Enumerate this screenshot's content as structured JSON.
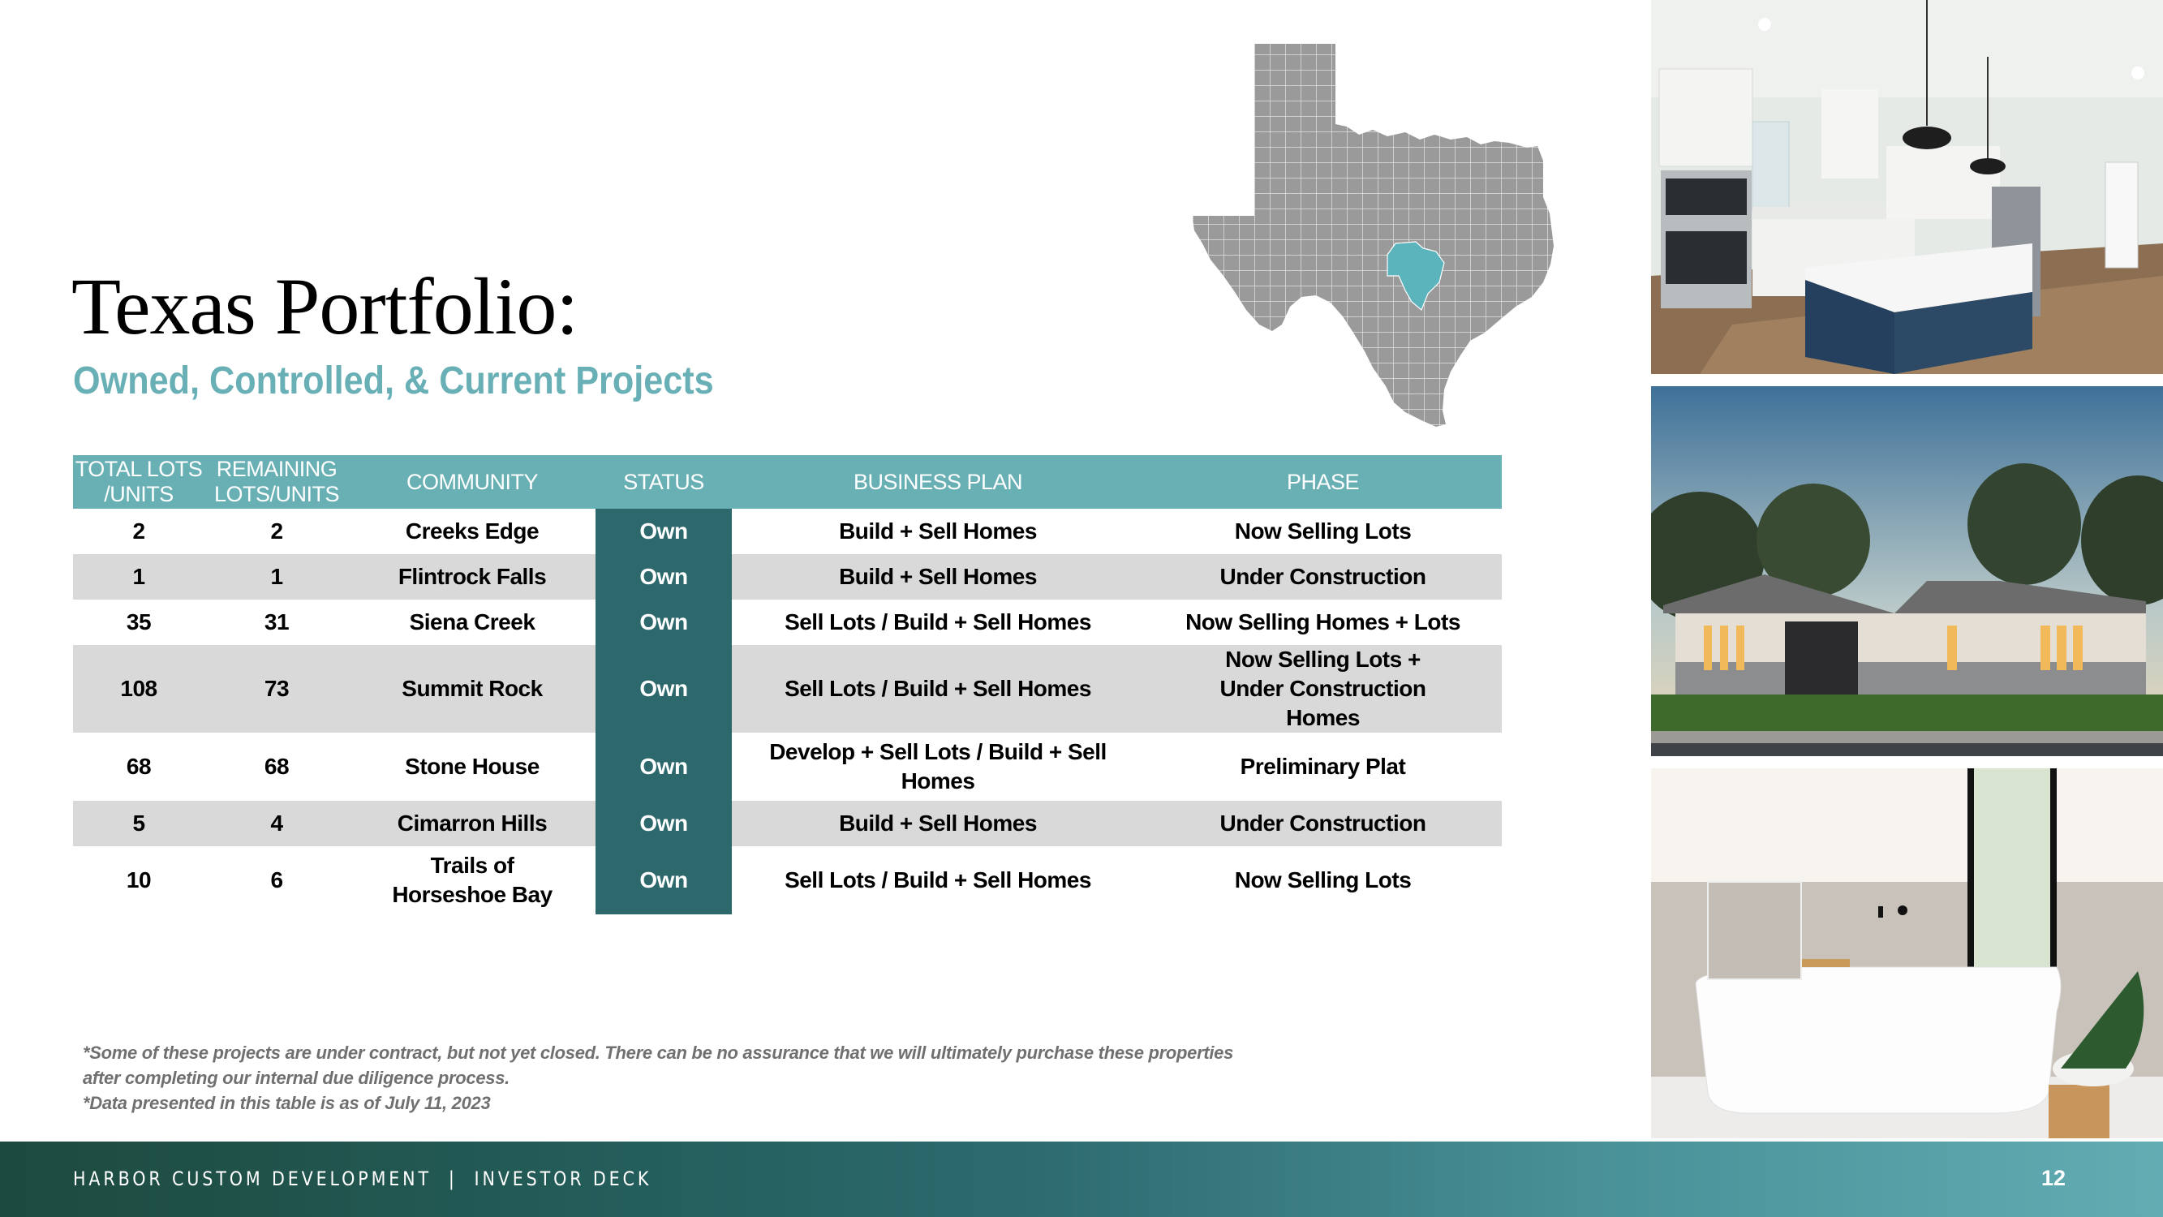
{
  "slide": {
    "title": "Texas Portfolio:",
    "subtitle": "Owned, Controlled,  & Current Projects"
  },
  "map": {
    "label": "Texas county map",
    "base_color": "#9A9A9A",
    "highlight_color": "#5BB3BC"
  },
  "table": {
    "headers": {
      "total": "TOTAL LOTS /UNITS",
      "remaining": "REMAINING LOTS/UNITS",
      "community": "COMMUNITY",
      "status": "STATUS",
      "business_plan": "BUSINESS PLAN",
      "phase": "PHASE"
    },
    "rows": [
      {
        "total": "2",
        "remaining": "2",
        "community": "Creeks Edge",
        "status": "Own",
        "business_plan": "Build + Sell Homes",
        "phase": "Now Selling Lots"
      },
      {
        "total": "1",
        "remaining": "1",
        "community": "Flintrock Falls",
        "status": "Own",
        "business_plan": "Build + Sell Homes",
        "phase": "Under Construction"
      },
      {
        "total": "35",
        "remaining": "31",
        "community": "Siena Creek",
        "status": "Own",
        "business_plan": "Sell Lots / Build + Sell Homes",
        "phase": "Now Selling Homes + Lots"
      },
      {
        "total": "108",
        "remaining": "73",
        "community": "Summit Rock",
        "status": "Own",
        "business_plan": "Sell Lots / Build + Sell Homes",
        "phase": "Now Selling Lots + Under Construction Homes"
      },
      {
        "total": "68",
        "remaining": "68",
        "community": "Stone House",
        "status": "Own",
        "business_plan": "Develop + Sell Lots / Build + Sell Homes",
        "phase": "Preliminary Plat"
      },
      {
        "total": "5",
        "remaining": "4",
        "community": "Cimarron Hills",
        "status": "Own",
        "business_plan": "Build + Sell Homes",
        "phase": "Under Construction"
      },
      {
        "total": "10",
        "remaining": "6",
        "community": "Trails of Horseshoe Bay",
        "status": "Own",
        "business_plan": "Sell Lots / Build + Sell Homes",
        "phase": "Now Selling Lots"
      }
    ]
  },
  "footnotes": [
    "*Some of these projects are under contract, but not yet closed. There can be no assurance that we will ultimately purchase these properties after completing our internal due diligence process.",
    "*Data presented in this table is as of July 11, 2023"
  ],
  "photos": [
    {
      "alt": "Kitchen interior with navy island and pendant lights"
    },
    {
      "alt": "Single-story home exterior at dusk"
    },
    {
      "alt": "Bathroom with freestanding tub and plant"
    }
  ],
  "footer": {
    "text": "HARBOR CUSTOM DEVELOPMENT  |  INVESTOR DECK",
    "page_number": "12"
  },
  "colors": {
    "accent_teal": "#69B0B5",
    "status_teal": "#2C686C",
    "row_gray": "#D9D9D9"
  }
}
